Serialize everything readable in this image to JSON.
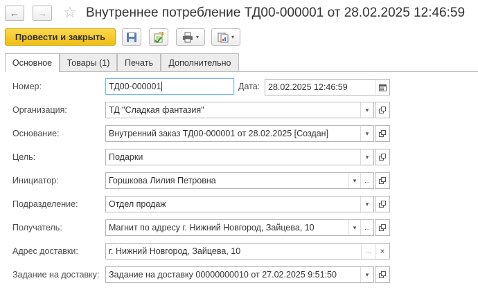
{
  "window": {
    "title": "Внутреннее потребление ТД00-000001 от 28.02.2025 12:46:59",
    "back_icon": "←",
    "forward_icon": "→",
    "star_icon": "☆"
  },
  "toolbar": {
    "primary_label": "Провести и закрыть",
    "accent_color": "#f2c318"
  },
  "tabs": [
    {
      "label": "Основное",
      "active": true
    },
    {
      "label": "Товары (1)",
      "active": false
    },
    {
      "label": "Печать",
      "active": false
    },
    {
      "label": "Дополнительно",
      "active": false
    }
  ],
  "form": {
    "number": {
      "label": "Номер:",
      "value": "ТД00-000001"
    },
    "date": {
      "label": "Дата:",
      "value": "28.02.2025 12:46:59"
    },
    "organization": {
      "label": "Организация:",
      "value": "ТД \"Сладкая фантазия\""
    },
    "basis": {
      "label": "Основание:",
      "value": "Внутренний заказ ТД00-000001 от 28.02.2025 [Создан]"
    },
    "purpose": {
      "label": "Цель:",
      "value": "Подарки"
    },
    "initiator": {
      "label": "Инициатор:",
      "value": "Горшкова Лилия Петровна"
    },
    "department": {
      "label": "Подразделение:",
      "value": "Отдел продаж"
    },
    "recipient": {
      "label": "Получатель:",
      "value": "Магнит по адресу г. Нижний Новгород, Зайцева, 10"
    },
    "delivery_address": {
      "label": "Адрес доставки:",
      "value": "г. Нижний Новгород, Зайцева, 10"
    },
    "delivery_task": {
      "label": "Задание на доставку:",
      "value": "Задание на доставку 00000000010 от 27.02.2025 9:51:50"
    }
  },
  "glyphs": {
    "dropdown": "▾",
    "select": "...",
    "clear": "×"
  }
}
